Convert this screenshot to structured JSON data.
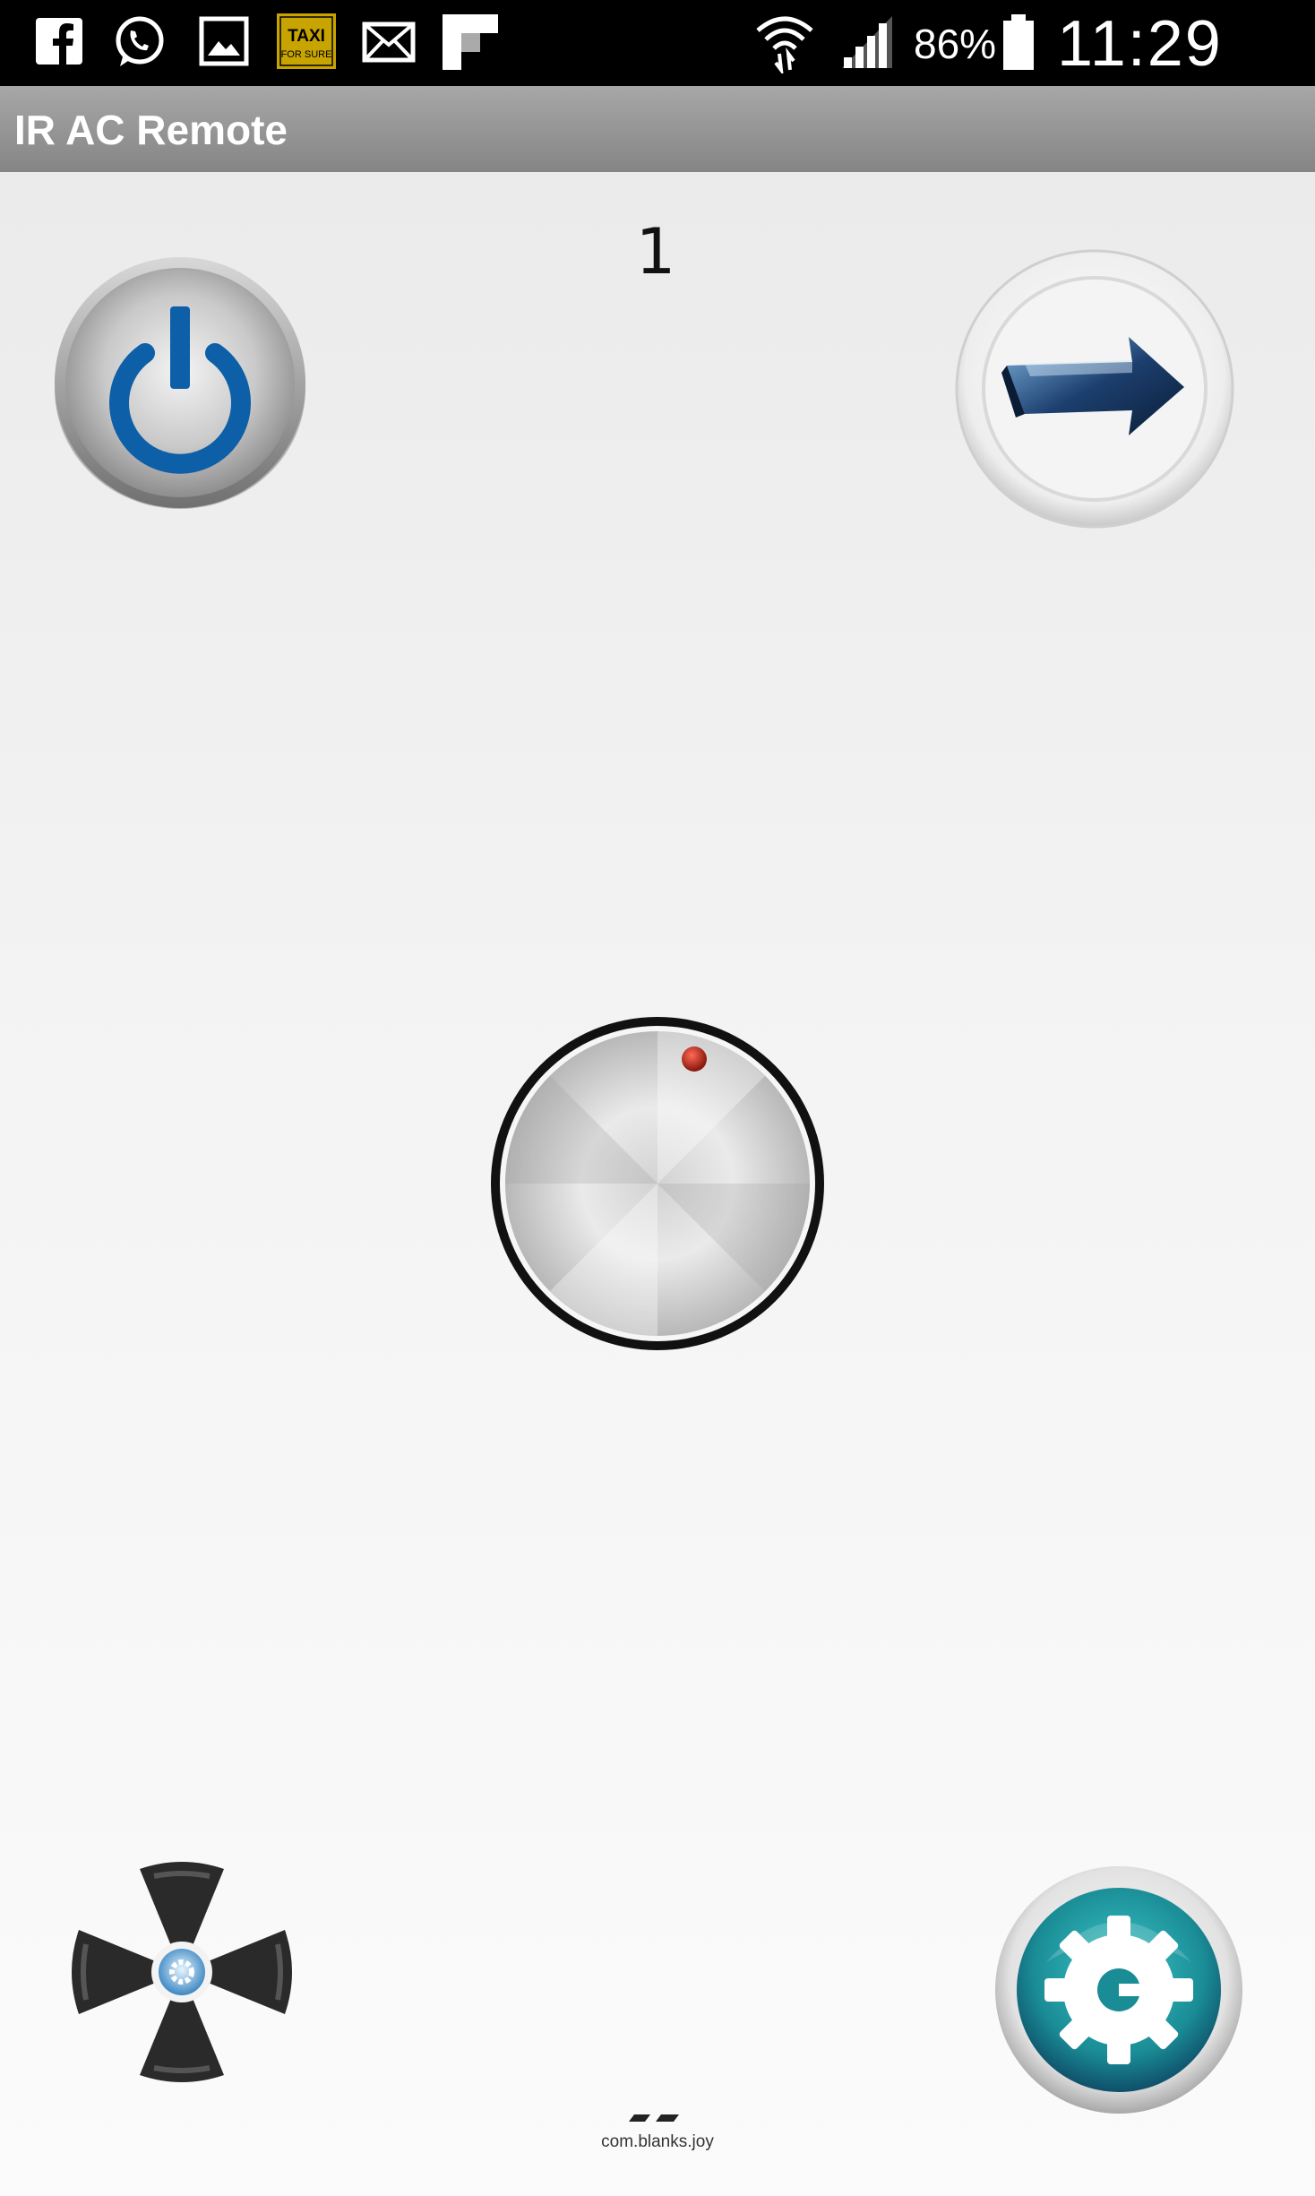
{
  "status_bar": {
    "notifications": [
      "facebook-icon",
      "whatsapp-icon",
      "gallery-icon",
      "taxi-for-sure-icon",
      "mail-icon",
      "flipboard-icon"
    ],
    "taxi_badge_line1": "TAXI",
    "taxi_badge_line2": "FOR SURE",
    "battery": "86%",
    "time": "11:29"
  },
  "app": {
    "title": "IR AC Remote"
  },
  "main": {
    "counter": "1",
    "buttons": [
      "power-icon",
      "next-arrow-icon",
      "dial-knob",
      "fan-icon",
      "settings-gear-icon"
    ]
  },
  "footer": {
    "package": "com.blanks.joy"
  },
  "colors": {
    "status_bar": "#000000",
    "action_bar": "#959595",
    "power_blue": "#0d5fa8",
    "settings_teal": "#1a8c95",
    "knob_indicator": "#c0281c"
  }
}
